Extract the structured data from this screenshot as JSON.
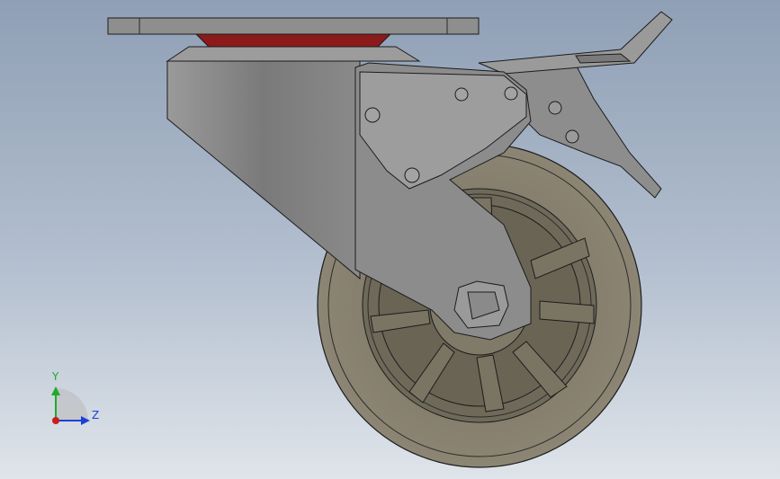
{
  "triad": {
    "y_label": "Y",
    "z_label": "Z",
    "y_color": "#1faa2a",
    "z_color": "#1d3fd6",
    "x_color": "#c81e1e"
  },
  "colors": {
    "background_top": "#8f9fb5",
    "background_bottom": "#dfe4ea",
    "metal": "#8a8a8a",
    "metal_light": "#a3a3a3",
    "metal_dark": "#6e6e6e",
    "wheel": "#6e6858",
    "wheel_light": "#8a8473",
    "rubber_pad": "#8b1a1a"
  }
}
